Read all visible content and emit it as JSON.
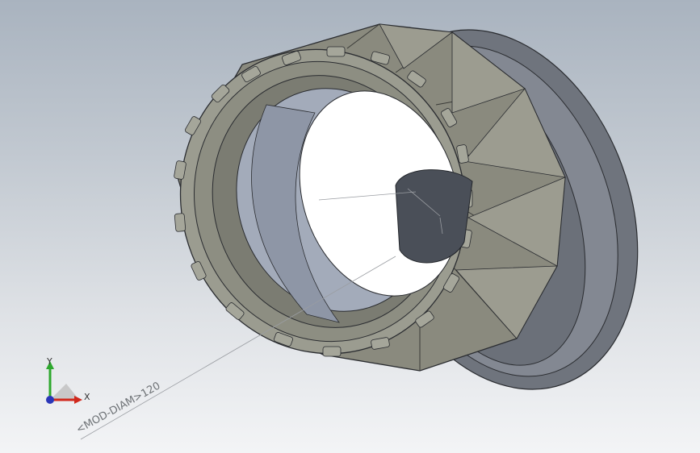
{
  "viewport": {
    "background_top": "#a9b3bf",
    "background_bottom": "#f3f4f6"
  },
  "model": {
    "body_color": "#8a8a7e",
    "flange_color": "#7c818a",
    "inner_color": "#9aa2b0",
    "shaft_color": "#4a4f58"
  },
  "triad": {
    "x_label": "X",
    "y_label": "Y",
    "x_color": "#d0281c",
    "y_color": "#2ea82e",
    "z_color": "#2a36b8"
  },
  "annotation": {
    "dimension_label": "<MOD-DIAM>120"
  }
}
